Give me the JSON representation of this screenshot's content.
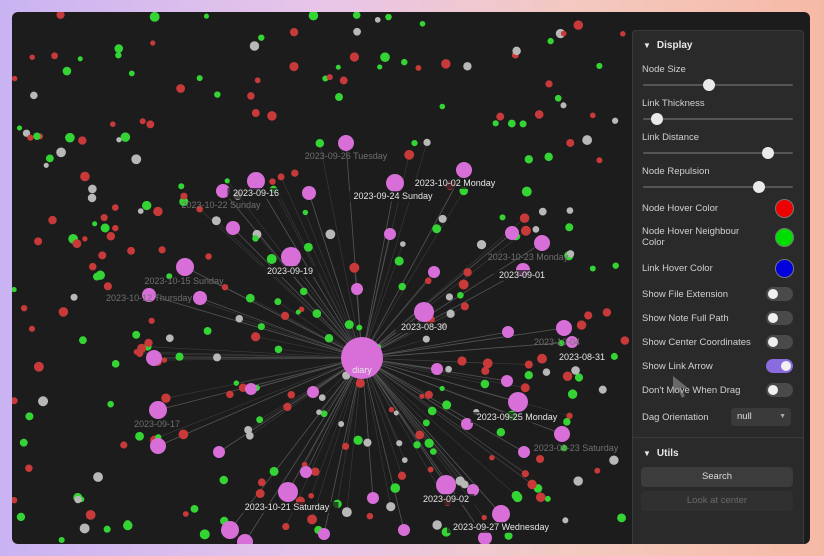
{
  "graph": {
    "center_node": "diary",
    "bright_labels": [
      "2023-09-16",
      "2023-09-24 Sunday",
      "2023-10-02 Monday",
      "2023-09-19",
      "2023-09-01",
      "2023-08-30",
      "2023-08-31",
      "2023-09-25 Monday",
      "2023-09-02",
      "2023-10-21 Saturday",
      "2023-09-27 Wednesday"
    ],
    "dim_labels": [
      "2023-09-26 Tuesday",
      "2023-10-22 Sunday",
      "2023-10-15 Sunday",
      "2023-10-12 Thursday",
      "2023-10-23 Monday",
      "2023-10-04",
      "2023-09-17",
      "2023-09-23 Saturday"
    ],
    "colors": {
      "pink": "#d86fd8",
      "green": "#35d435",
      "red": "#c83a3a",
      "grey": "#b8b8b8"
    }
  },
  "panel": {
    "display": {
      "title": "Display",
      "sliders": [
        {
          "label": "Node Size",
          "value": 0.44
        },
        {
          "label": "Link Thickness",
          "value": 0.09
        },
        {
          "label": "Link Distance",
          "value": 0.83
        },
        {
          "label": "Node Repulsion",
          "value": 0.77
        }
      ],
      "colors": [
        {
          "label": "Node Hover Color",
          "color": "#ee0000"
        },
        {
          "label": "Node Hover Neighbour Color",
          "color": "#00dd00"
        },
        {
          "label": "Link Hover Color",
          "color": "#0000dd"
        }
      ],
      "toggles": [
        {
          "label": "Show File Extension",
          "on": false
        },
        {
          "label": "Show Note Full Path",
          "on": false
        },
        {
          "label": "Show Center Coordinates",
          "on": false
        },
        {
          "label": "Show Link Arrow",
          "on": true
        },
        {
          "label": "Don't Move When Drag",
          "on": false
        }
      ],
      "dag_label": "Dag Orientation",
      "dag_value": "null"
    },
    "utils": {
      "title": "Utils",
      "search_label": "Search",
      "look_label": "Look at center"
    }
  }
}
